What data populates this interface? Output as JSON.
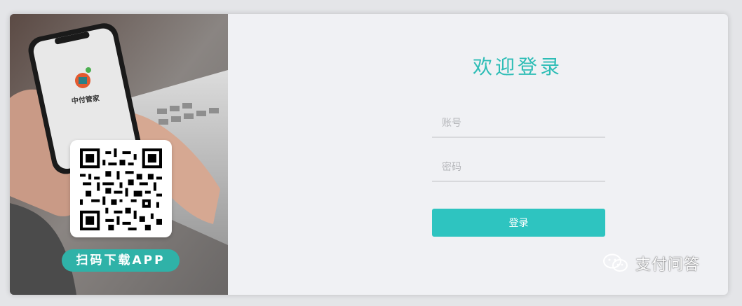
{
  "left": {
    "app_name": "中付管家",
    "download_label": "扫码下载APP"
  },
  "login": {
    "title": "欢迎登录",
    "account_placeholder": "账号",
    "password_placeholder": "密码",
    "submit_label": "登录"
  },
  "watermark": {
    "text": "支付问答"
  },
  "colors": {
    "accent": "#2ec4c0",
    "title": "#2ebdb6",
    "pill": "#2fb2a8"
  }
}
